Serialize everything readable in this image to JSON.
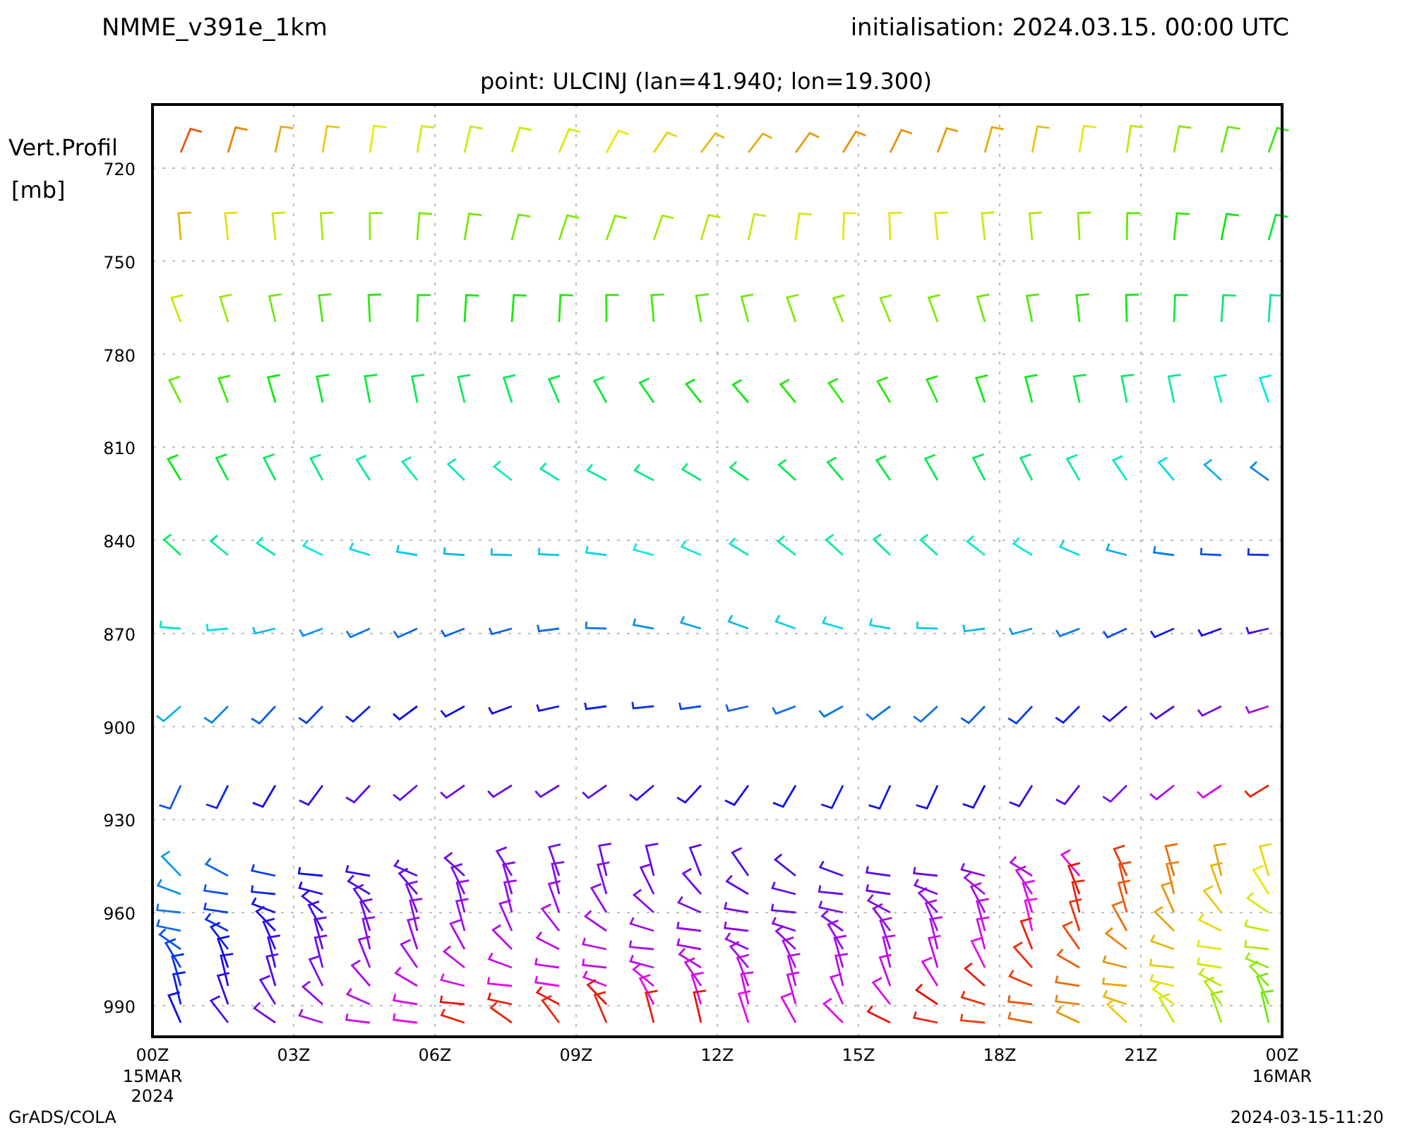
{
  "title": "NMME_v391e_1km",
  "initialisation": "initialisation: 2024.03.15. 00:00 UTC",
  "point": "point: ULCINJ (lan=41.940; lon=19.300)",
  "y_axis": {
    "label": "Vert.Profil",
    "unit": "[mb]",
    "ticks": [
      "720",
      "750",
      "780",
      "810",
      "840",
      "870",
      "900",
      "930",
      "960",
      "990"
    ]
  },
  "x_axis": {
    "ticks": [
      {
        "label": "00Z",
        "lines": [
          "15MAR",
          "2024"
        ]
      },
      {
        "label": "03Z"
      },
      {
        "label": "06Z"
      },
      {
        "label": "09Z"
      },
      {
        "label": "12Z"
      },
      {
        "label": "15Z"
      },
      {
        "label": "18Z"
      },
      {
        "label": "21Z"
      },
      {
        "label": "00Z",
        "lines": [
          "16MAR"
        ]
      }
    ]
  },
  "footer": {
    "left": "GrADS/COLA",
    "right": "2024-03-15-11:20"
  }
}
